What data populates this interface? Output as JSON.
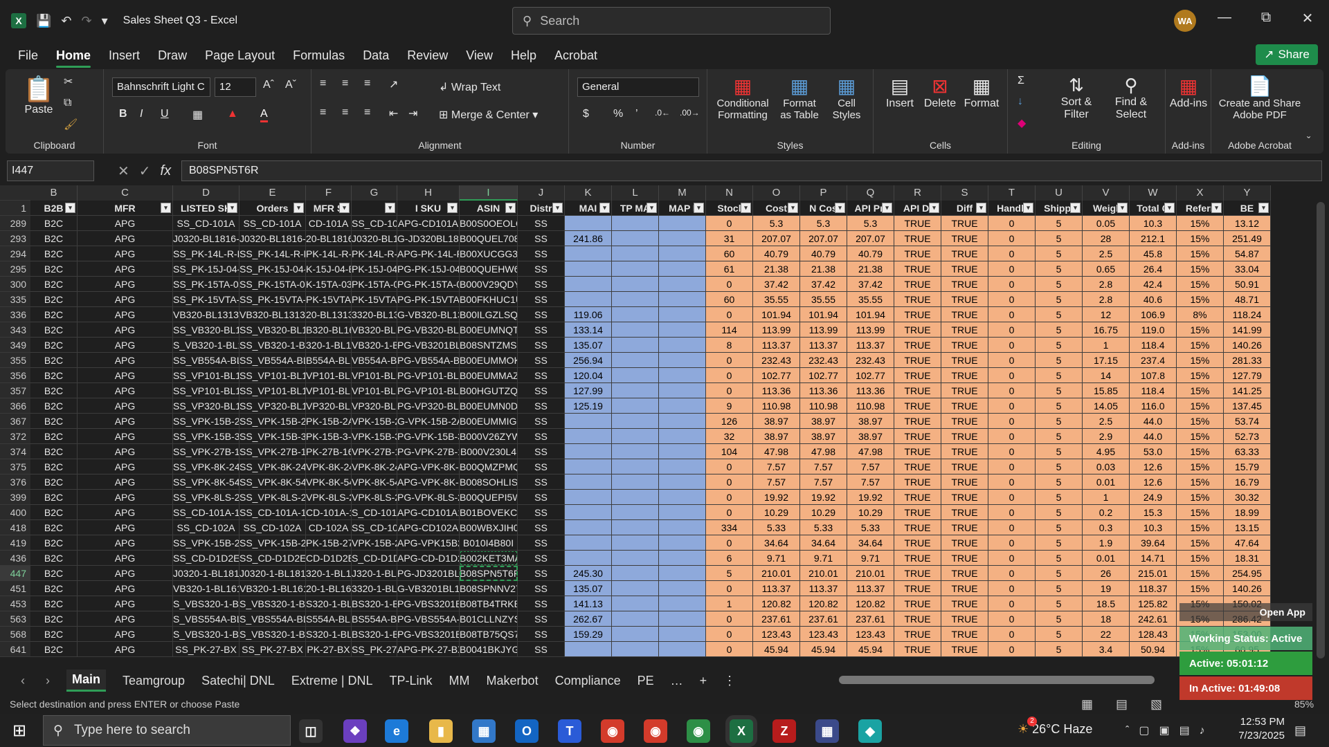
{
  "app": {
    "title": "Sales Sheet Q3  -  Excel",
    "search_placeholder": "Search",
    "avatar": "WA",
    "share": "Share",
    "logo": "X"
  },
  "menu": [
    "File",
    "Home",
    "Insert",
    "Draw",
    "Page Layout",
    "Formulas",
    "Data",
    "Review",
    "View",
    "Help",
    "Acrobat"
  ],
  "ribbon": {
    "paste": "Paste",
    "clipboard": "Clipboard",
    "font_name": "Bahnschrift Light C",
    "font_size": "12",
    "font": "Font",
    "bold": "B",
    "italic": "I",
    "underline": "U",
    "wrap": "Wrap Text",
    "merge": "Merge & Center",
    "alignment": "Alignment",
    "number_format": "General",
    "number": "Number",
    "cond": "Conditional Formatting",
    "fmt_table": "Format as Table",
    "cell_styles": "Cell Styles",
    "styles": "Styles",
    "insert": "Insert",
    "delete": "Delete",
    "format": "Format",
    "cells": "Cells",
    "sort": "Sort & Filter",
    "find": "Find & Select",
    "editing": "Editing",
    "addins": "Add-ins",
    "addins_group": "Add-ins",
    "acrobat": "Create and Share Adobe PDF",
    "acrobat_group": "Adobe Acrobat"
  },
  "formula": {
    "namebox": "I447",
    "value": "B08SPN5T6R"
  },
  "columns": [
    "B",
    "C",
    "D",
    "E",
    "F",
    "G",
    "H",
    "I",
    "J",
    "K",
    "L",
    "M",
    "N",
    "O",
    "P",
    "Q",
    "R",
    "S",
    "T",
    "U",
    "V",
    "W",
    "X",
    "Y"
  ],
  "headers": [
    "B2B",
    "MFR",
    "LISTED SK",
    "Orders",
    "MFR S",
    "",
    "I SKU",
    "ASIN",
    "Distr",
    "MAI",
    "TP MA",
    "MAP I",
    "Stocl",
    "Cost",
    "N Cos",
    "API Pri",
    "API Di",
    "Diff",
    "Handli",
    "Shippi",
    "Weigl",
    "Total C",
    "Referr",
    "BE"
  ],
  "rows": [
    {
      "n": "289",
      "c": [
        "B2C",
        "APG",
        "SS_CD-101A",
        "SS_CD-101A",
        "CD-101A",
        "SS_CD-101A",
        "APG-CD101A",
        "B00S0OEOLO",
        "SS",
        "",
        "",
        "",
        "0",
        "5.3",
        "5.3",
        "5.3",
        "TRUE",
        "TRUE",
        "0",
        "5",
        "0.05",
        "10.3",
        "15%",
        "13.12"
      ]
    },
    {
      "n": "293",
      "c": [
        "B2C",
        "APG",
        "J0320-BL1816-C",
        "J0320-BL1816-C",
        "20-BL1816-0",
        "J0320-BL1816",
        "G-JD320BL1816",
        "B00QUEL708",
        "SS",
        "241.86",
        "",
        "",
        "31",
        "207.07",
        "207.07",
        "207.07",
        "TRUE",
        "TRUE",
        "0",
        "5",
        "28",
        "212.1",
        "15%",
        "251.49"
      ]
    },
    {
      "n": "294",
      "c": [
        "B2C",
        "APG",
        "SS_PK-14L-R-BX",
        "SS_PK-14L-R-BX",
        "PK-14L-R-BX",
        "PK-14L-R-",
        "APG-PK-14L-R-B",
        "B00XUCGG30",
        "SS",
        "",
        "",
        "",
        "60",
        "40.79",
        "40.79",
        "40.79",
        "TRUE",
        "TRUE",
        "0",
        "5",
        "2.5",
        "45.8",
        "15%",
        "54.87"
      ]
    },
    {
      "n": "295",
      "c": [
        "B2C",
        "APG",
        "SS_PK-15J-04-BX",
        "SS_PK-15J-04-BX",
        "K-15J-04-B",
        "PK-15J-04-",
        "PG-PK-15J-04-B",
        "B00QUEHW60",
        "SS",
        "",
        "",
        "",
        "61",
        "21.38",
        "21.38",
        "21.38",
        "TRUE",
        "TRUE",
        "0",
        "5",
        "0.65",
        "26.4",
        "15%",
        "33.04"
      ]
    },
    {
      "n": "300",
      "c": [
        "B2C",
        "APG",
        "SS_PK-15TA-03-BX",
        "SS_PK-15TA-03-BX",
        "K-15TA-03-B",
        "PK-15TA-03",
        "PG-PK-15TA-03-",
        "B000V29QDY",
        "SS",
        "",
        "",
        "",
        "0",
        "37.42",
        "37.42",
        "37.42",
        "TRUE",
        "TRUE",
        "0",
        "5",
        "2.8",
        "42.4",
        "15%",
        "50.91"
      ]
    },
    {
      "n": "335",
      "c": [
        "B2C",
        "APG",
        "SS_PK-15VTA-BX",
        "SS_PK-15VTA-BX",
        "PK-15VTA-BX",
        "PK-15VTA-",
        "PG-PK-15VTA-B",
        "B00FKHUC1U",
        "SS",
        "",
        "",
        "",
        "60",
        "35.55",
        "35.55",
        "35.55",
        "TRUE",
        "TRUE",
        "0",
        "5",
        "2.8",
        "40.6",
        "15%",
        "48.71"
      ]
    },
    {
      "n": "336",
      "c": [
        "B2C",
        "APG",
        "VB320-BL1313-B",
        "VB320-BL1313-B",
        "20-BL1313-",
        "3320-BL1313",
        "G-VB320-BL1313",
        "B00ILGZLSQ",
        "SS",
        "119.06",
        "",
        "",
        "0",
        "101.94",
        "101.94",
        "101.94",
        "TRUE",
        "TRUE",
        "0",
        "5",
        "12",
        "106.9",
        "8%",
        "118.24"
      ]
    },
    {
      "n": "343",
      "c": [
        "B2C",
        "APG",
        "SS_VB320-BL1616",
        "SS_VB320-BL1616",
        "B320-BL161",
        "VB320-BL16",
        "PG-VB320-BL161",
        "B00EUMNQTG",
        "SS",
        "133.14",
        "",
        "",
        "114",
        "113.99",
        "113.99",
        "113.99",
        "TRUE",
        "TRUE",
        "0",
        "5",
        "16.75",
        "119.0",
        "15%",
        "141.99"
      ]
    },
    {
      "n": "349",
      "c": [
        "B2C",
        "APG",
        "S_VB320-1-BL161",
        "SS_VB320-1-BL161",
        "320-1-BL16",
        "VB320-1-BL1",
        "PG-VB3201BL161",
        "B08SNTZMSK",
        "SS",
        "135.07",
        "",
        "",
        "8",
        "113.37",
        "113.37",
        "113.37",
        "TRUE",
        "TRUE",
        "0",
        "5",
        "1",
        "118.4",
        "15%",
        "140.26"
      ]
    },
    {
      "n": "355",
      "c": [
        "B2C",
        "APG",
        "SS_VB554A-BL161",
        "SS_VB554A-BL161",
        "B554A-BL16",
        "VB554A-BL1",
        "PG-VB554A-BL16",
        "B00EUMMOKS",
        "SS",
        "256.94",
        "",
        "",
        "0",
        "232.43",
        "232.43",
        "232.43",
        "TRUE",
        "TRUE",
        "0",
        "5",
        "17.15",
        "237.4",
        "15%",
        "281.33"
      ]
    },
    {
      "n": "356",
      "c": [
        "B2C",
        "APG",
        "SS_VP101-BL1416",
        "SS_VP101-BL1416",
        "VP101-BL141",
        "VP101-BL14",
        "PG-VP101-BL141",
        "B00EUMMAZW",
        "SS",
        "120.04",
        "",
        "",
        "0",
        "102.77",
        "102.77",
        "102.77",
        "TRUE",
        "TRUE",
        "0",
        "5",
        "14",
        "107.8",
        "15%",
        "127.79"
      ]
    },
    {
      "n": "357",
      "c": [
        "B2C",
        "APG",
        "SS_VP101-BL1616",
        "SS_VP101-BL1616",
        "VP101-BL161",
        "VP101-BL16",
        "PG-VP101-BL161",
        "B00HGUTZQW",
        "SS",
        "127.99",
        "",
        "",
        "0",
        "113.36",
        "113.36",
        "113.36",
        "TRUE",
        "TRUE",
        "0",
        "5",
        "15.85",
        "118.4",
        "15%",
        "141.25"
      ]
    },
    {
      "n": "366",
      "c": [
        "B2C",
        "APG",
        "SS_VP320-BL1416",
        "SS_VP320-BL1416",
        "VP320-BL141",
        "VP320-BL14",
        "PG-VP320-BL141",
        "B00EUMN0D4",
        "SS",
        "125.19",
        "",
        "",
        "9",
        "110.98",
        "110.98",
        "110.98",
        "TRUE",
        "TRUE",
        "0",
        "5",
        "14.05",
        "116.0",
        "15%",
        "137.45"
      ]
    },
    {
      "n": "367",
      "c": [
        "B2C",
        "APG",
        "SS_VPK-15B-2A-BX",
        "SS_VPK-15B-2A-BX",
        "PK-15B-2A-B",
        "VPK-15B-2A",
        "G-VPK-15B-2A-",
        "B00EUMMIGU",
        "SS",
        "",
        "",
        "",
        "126",
        "38.97",
        "38.97",
        "38.97",
        "TRUE",
        "TRUE",
        "0",
        "5",
        "2.5",
        "44.0",
        "15%",
        "53.74"
      ]
    },
    {
      "n": "372",
      "c": [
        "B2C",
        "APG",
        "SS_VPK-15B-3-BX",
        "SS_VPK-15B-3-BX",
        "PK-15B-3-B",
        "VPK-15B-3-",
        "PG-VPK-15B-3-B",
        "B000V26ZYW",
        "SS",
        "",
        "",
        "",
        "32",
        "38.97",
        "38.97",
        "38.97",
        "TRUE",
        "TRUE",
        "0",
        "5",
        "2.9",
        "44.0",
        "15%",
        "52.73"
      ]
    },
    {
      "n": "374",
      "c": [
        "B2C",
        "APG",
        "SS_VPK-27B-16-BX",
        "SS_VPK-27B-16-BX",
        "PK-27B-16-B",
        "VPK-27B-16",
        "PG-VPK-27B-16-",
        "B000V230L4",
        "SS",
        "",
        "",
        "",
        "104",
        "47.98",
        "47.98",
        "47.98",
        "TRUE",
        "TRUE",
        "0",
        "5",
        "4.95",
        "53.0",
        "15%",
        "63.33"
      ]
    },
    {
      "n": "375",
      "c": [
        "B2C",
        "APG",
        "SS_VPK-8K-243",
        "SS_VPK-8K-243",
        "VPK-8K-243",
        "VPK-8K-24",
        "APG-VPK-8K-243",
        "B00QMZPMQY",
        "SS",
        "",
        "",
        "",
        "0",
        "7.57",
        "7.57",
        "7.57",
        "TRUE",
        "TRUE",
        "0",
        "5",
        "0.03",
        "12.6",
        "15%",
        "15.79"
      ]
    },
    {
      "n": "376",
      "c": [
        "B2C",
        "APG",
        "SS_VPK-8K-542",
        "SS_VPK-8K-542",
        "VPK-8K-542",
        "VPK-8K-54",
        "APG-VPK-8K-542",
        "B008SOHLIS",
        "SS",
        "",
        "",
        "",
        "0",
        "7.57",
        "7.57",
        "7.57",
        "TRUE",
        "TRUE",
        "0",
        "5",
        "0.01",
        "12.6",
        "15%",
        "16.79"
      ]
    },
    {
      "n": "399",
      "c": [
        "B2C",
        "APG",
        "SS_VPK-8LS-235",
        "SS_VPK-8LS-235",
        "VPK-8LS-235",
        "VPK-8LS-2",
        "PG-VPK-8LS-235",
        "B00QUEPI5W",
        "SS",
        "",
        "",
        "",
        "0",
        "19.92",
        "19.92",
        "19.92",
        "TRUE",
        "TRUE",
        "0",
        "5",
        "1",
        "24.9",
        "15%",
        "30.32"
      ]
    },
    {
      "n": "400",
      "c": [
        "B2C",
        "APG",
        "SS_CD-101A-10",
        "SS_CD-101A-10",
        "CD-101A-10",
        "S_CD-101A-",
        "APG-CD101A10",
        "B01BOVEKCW",
        "SS",
        "",
        "",
        "",
        "0",
        "10.29",
        "10.29",
        "10.29",
        "TRUE",
        "TRUE",
        "0",
        "5",
        "0.2",
        "15.3",
        "15%",
        "18.99"
      ]
    },
    {
      "n": "418",
      "c": [
        "B2C",
        "APG",
        "SS_CD-102A",
        "SS_CD-102A",
        "CD-102A",
        "SS_CD-102A",
        "APG-CD102A",
        "B00WBXJIH0",
        "SS",
        "",
        "",
        "",
        "334",
        "5.33",
        "5.33",
        "5.33",
        "TRUE",
        "TRUE",
        "0",
        "5",
        "0.3",
        "10.3",
        "15%",
        "13.15"
      ]
    },
    {
      "n": "419",
      "c": [
        "B2C",
        "APG",
        "SS_VPK-15B-27-BX",
        "SS_VPK-15B-27-BX",
        "PK-15B-27-B",
        "VPK-15B-27",
        "APG-VPK15B27BX",
        "B010I4B80I",
        "SS",
        "",
        "",
        "",
        "0",
        "34.64",
        "34.64",
        "34.64",
        "TRUE",
        "TRUE",
        "0",
        "5",
        "1.9",
        "39.64",
        "15%",
        "47.64"
      ]
    },
    {
      "n": "436",
      "c": [
        "B2C",
        "APG",
        "SS_CD-D1D2EP",
        "SS_CD-D1D2EP",
        "CD-D1D2EP",
        "S_CD-D1D2E",
        "APG-CD-D1D2EP",
        "B002KET3MA",
        "SS",
        "",
        "",
        "",
        "6",
        "9.71",
        "9.71",
        "9.71",
        "TRUE",
        "TRUE",
        "0",
        "5",
        "0.01",
        "14.71",
        "15%",
        "18.31"
      ]
    },
    {
      "n": "447",
      "c": [
        "B2C",
        "APG",
        "J0320-1-BL1816",
        "J0320-1-BL1816",
        "320-1-BL181",
        "J320-1-BL18",
        "PG-JD3201BL181",
        "B08SPN5T6R",
        "SS",
        "245.30",
        "",
        "",
        "5",
        "210.01",
        "210.01",
        "210.01",
        "TRUE",
        "TRUE",
        "0",
        "5",
        "26",
        "215.01",
        "15%",
        "254.95"
      ]
    },
    {
      "n": "451",
      "c": [
        "B2C",
        "APG",
        "VB320-1-BL1616-",
        "VB320-1-BL1616-",
        "20-1-BL1616",
        "3320-1-BL16",
        "G-VB3201BL1616",
        "B08SPNNV27",
        "SS",
        "135.07",
        "",
        "",
        "0",
        "113.37",
        "113.37",
        "113.37",
        "TRUE",
        "TRUE",
        "0",
        "5",
        "19",
        "118.37",
        "15%",
        "140.26"
      ]
    },
    {
      "n": "453",
      "c": [
        "B2C",
        "APG",
        "S_VBS320-1-BL16",
        "S_VBS320-1-BL16",
        "S320-1-BL16",
        "BS320-1-BL",
        "PG-VBS3201BL16",
        "B08TB4TRKB",
        "SS",
        "141.13",
        "",
        "",
        "1",
        "120.82",
        "120.82",
        "120.82",
        "TRUE",
        "TRUE",
        "0",
        "5",
        "18.5",
        "125.82",
        "15%",
        "150.02"
      ]
    },
    {
      "n": "563",
      "c": [
        "B2C",
        "APG",
        "S_VBS554A-BL16",
        "S_VBS554A-BL16",
        "S554A-BL16",
        "BS554A-BL1",
        "PG-VBS554A-BL16",
        "B01CLLNZYS",
        "SS",
        "262.67",
        "",
        "",
        "0",
        "237.61",
        "237.61",
        "237.61",
        "TRUE",
        "TRUE",
        "0",
        "5",
        "18",
        "242.61",
        "15%",
        "286.42"
      ]
    },
    {
      "n": "568",
      "c": [
        "B2C",
        "APG",
        "S_VBS320-1-BL19",
        "S_VBS320-1-BL19",
        "S320-1-BL19",
        "BS320-1-BL",
        "PG-VBS3201BL19",
        "B08TB75QS7",
        "SS",
        "159.29",
        "",
        "",
        "0",
        "123.43",
        "123.43",
        "123.43",
        "TRUE",
        "TRUE",
        "0",
        "5",
        "22",
        "128.43",
        "15%",
        "153.00"
      ]
    },
    {
      "n": "641",
      "c": [
        "B2C",
        "APG",
        "SS_PK-27-BX",
        "SS_PK-27-BX",
        "PK-27-BX",
        "SS_PK-27-BX",
        "APG-PK-27-BX",
        "B0041BKJYG",
        "SS",
        "",
        "",
        "",
        "0",
        "45.94",
        "45.94",
        "45.94",
        "TRUE",
        "TRUE",
        "0",
        "5",
        "3.4",
        "50.94",
        "15%",
        "60.95"
      ]
    }
  ],
  "tabs": [
    "Main",
    "Teamgroup",
    "Satechi| DNL",
    "Extreme | DNL",
    "TP-Link",
    "MM",
    "Makerbot",
    "Compliance",
    "PE"
  ],
  "status": "Select destination and press ENTER or choose Paste",
  "zoom": "85%",
  "overlay": {
    "open": "Open App",
    "working": "Working Status: Active",
    "active": "Active: 05:01:12",
    "inactive": "In Active: 01:49:08"
  },
  "taskbar": {
    "search": "Type here to search",
    "weather": "26°C  Haze",
    "time": "12:53 PM",
    "date": "7/23/2025",
    "badge": "2"
  },
  "colors": {
    "excel_green": "#1d6f42",
    "accent": "#2f9e57",
    "blue_fill": "#8ea9db",
    "orange_fill": "#f4b183"
  }
}
